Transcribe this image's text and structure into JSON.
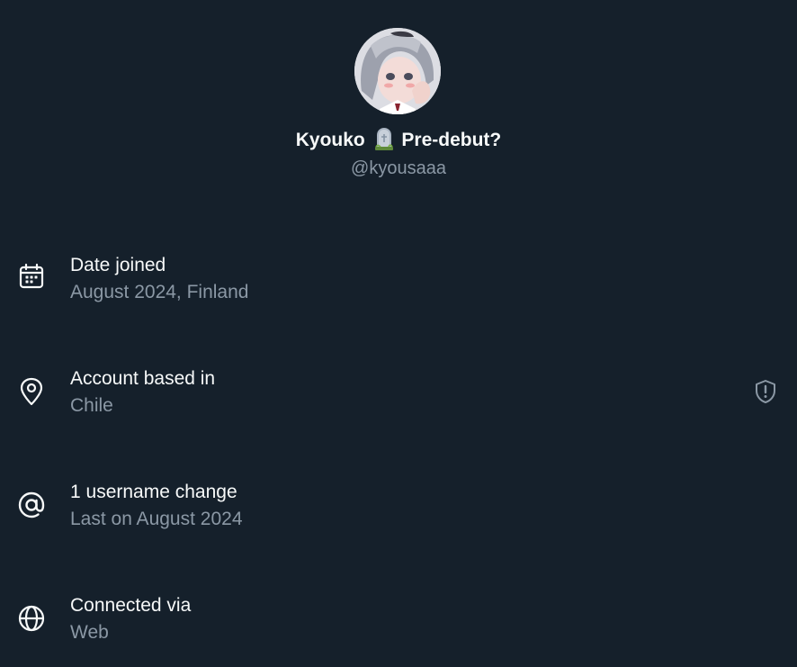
{
  "profile": {
    "display_name_before": "Kyouko",
    "display_name_emoji": "headstone-emoji",
    "display_name_after": "Pre-debut?",
    "handle": "@kyousaaa"
  },
  "details": [
    {
      "icon": "calendar-icon",
      "title": "Date joined",
      "subtitle": "August 2024, Finland"
    },
    {
      "icon": "location-pin-icon",
      "title": "Account based in",
      "subtitle": "Chile",
      "badge_icon": "shield-alert-icon"
    },
    {
      "icon": "at-sign-icon",
      "title": "1 username change",
      "subtitle": "Last on August 2024"
    },
    {
      "icon": "globe-icon",
      "title": "Connected via",
      "subtitle": "Web"
    }
  ],
  "colors": {
    "background": "#15202b",
    "primary_text": "#f7f9f9",
    "secondary_text": "#8b98a5"
  }
}
